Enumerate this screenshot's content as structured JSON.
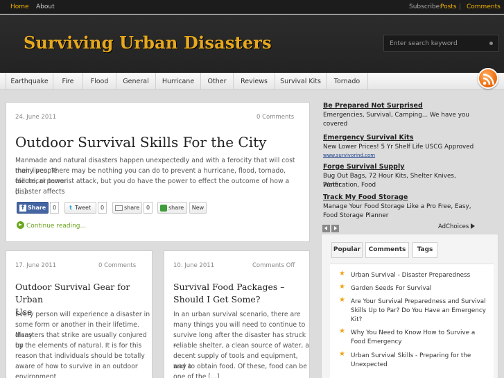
{
  "topbar": {
    "home": "Home",
    "about": "About",
    "subscribe": "Subscribe:",
    "posts": "Posts",
    "separator": "|",
    "comments": "Comments"
  },
  "header": {
    "logo": "Surviving Urban Disasters",
    "search_placeholder": "Enter search keyword"
  },
  "nav": {
    "items": [
      "Earthquake",
      "Fire",
      "Flood",
      "General",
      "Hurricane",
      "Other",
      "Reviews",
      "Survival Kits",
      "Tornado"
    ]
  },
  "featured": {
    "date": "24. June 2011",
    "comments": "0 Comments",
    "title": "Outdoor Survival Skills For the City",
    "excerpt_lines": [
      "Manmade and natural disasters happen unexpectedly and with a ferocity that will cost many people",
      "their lives. There may be nothing you can do to prevent a hurricane, flood, tornado, electrical power",
      "failure, or terrorist attack, but you do have the power to effect the outcome of how a disaster affects",
      "[...]"
    ],
    "share": {
      "facebook": "Share",
      "facebook_count": "0",
      "twitter": "Tweet",
      "twitter_count": "0",
      "email": "share",
      "email_count": "0",
      "sharethis": "share",
      "new": "New"
    },
    "continue": "Continue reading..."
  },
  "posts": [
    {
      "date": "17. June 2011",
      "comments": "0 Comments",
      "title_lines": [
        "Outdoor Survival Gear for Urban",
        "Use"
      ],
      "excerpt_lines": [
        "Every person will experience a disaster in",
        "some form or another in their lifetime. Many",
        "disasters that strike are usually conjured up",
        "by the elements of natural. It is for this",
        "reason that individuals should be totally",
        "aware of how to survive in an outdoor",
        "environment"
      ]
    },
    {
      "date": "10. June 2011",
      "comments": "Comments Off",
      "title_lines": [
        "Survival Food Packages –",
        "Should I Get Some?"
      ],
      "excerpt_lines": [
        "In an urban survival scenario, there are",
        "many things you will need to continue to",
        "survive long after the disaster has struck –",
        "reliable shelter, a clean source of water, a",
        "decent supply of tools and equipment, and a",
        "way to obtain food. Of these, food can be",
        "one of the [...]"
      ]
    }
  ],
  "ads": [
    {
      "headline": "Be Prepared Not Surprised",
      "text_lines": [
        "Emergencies, Survival, Camping... We have you",
        "covered"
      ],
      "url": ""
    },
    {
      "headline": "Emergency Survival Kits",
      "text_lines": [
        "New Lower Prices! 5 Yr Shelf Life USCG Approved"
      ],
      "url": "www.survivorind.com"
    },
    {
      "headline": "Forge Survival Supply",
      "text_lines": [
        "Bug Out Bags, 72 Hour Kits, Shelter Knives, Water",
        "Purification, Food"
      ],
      "url": ""
    },
    {
      "headline": "Track My Food Storage",
      "text_lines": [
        "Manage Your Food Storage Like a Pro Free, Easy,",
        "Food Storage Planner"
      ],
      "url": ""
    }
  ],
  "adchoices": "AdChoices",
  "tabs": {
    "labels": [
      "Popular",
      "Comments",
      "Tags"
    ],
    "active": "Popular",
    "popular": [
      [
        "Urban Survival - Disaster Preparedness"
      ],
      [
        "Garden Seeds For Survival"
      ],
      [
        "Are Your Survival Preparedness and Survival",
        "Skills Up to Par? Do You Have an Emergency",
        "Kit?"
      ],
      [
        "Why You Need to Know How to Survive a",
        "Food Emergency"
      ],
      [
        "Urban Survival Skills - Preparing for the",
        "Unexpected"
      ]
    ]
  },
  "colors": {
    "accent": "#e7a81c",
    "header_bg": "#262626",
    "link_green": "#6ba31c",
    "star": "#f0a316"
  },
  "icons": [
    "rss-icon",
    "facebook-icon",
    "twitter-icon",
    "email-icon",
    "sharethis-icon",
    "continue-arrow-icon",
    "star-icon",
    "adchoices-icon"
  ]
}
